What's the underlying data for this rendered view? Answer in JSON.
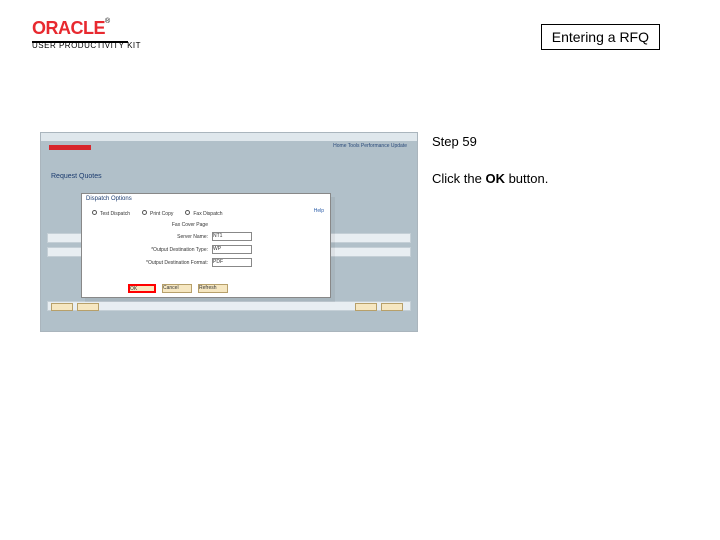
{
  "header": {
    "title": "Entering a RFQ"
  },
  "logo": {
    "brand": "ORACLE",
    "tm": "®",
    "product": "USER PRODUCTIVITY KIT"
  },
  "step": {
    "label": "Step 59",
    "text_prefix": "Click the ",
    "text_bold": "OK",
    "text_suffix": " button."
  },
  "shot": {
    "region_title": "Request Quotes",
    "nav": "Home   Tools   Performance Update   ",
    "popup_title": "Dispatch Options",
    "popup_help": "Help",
    "radio1": "Test Dispatch",
    "radio2": "Print Copy",
    "radio3": "Fax Dispatch",
    "row1_label": "Fax Cover Page",
    "row2_label": "Server Name:",
    "row2_value": "NT1",
    "row3_label": "*Output Destination Type:",
    "row3_value": "WP",
    "row4_label": "*Output Destination Format:",
    "row4_value": "PDF",
    "ok": "OK",
    "cancel": "Cancel",
    "refresh": "Refresh"
  }
}
